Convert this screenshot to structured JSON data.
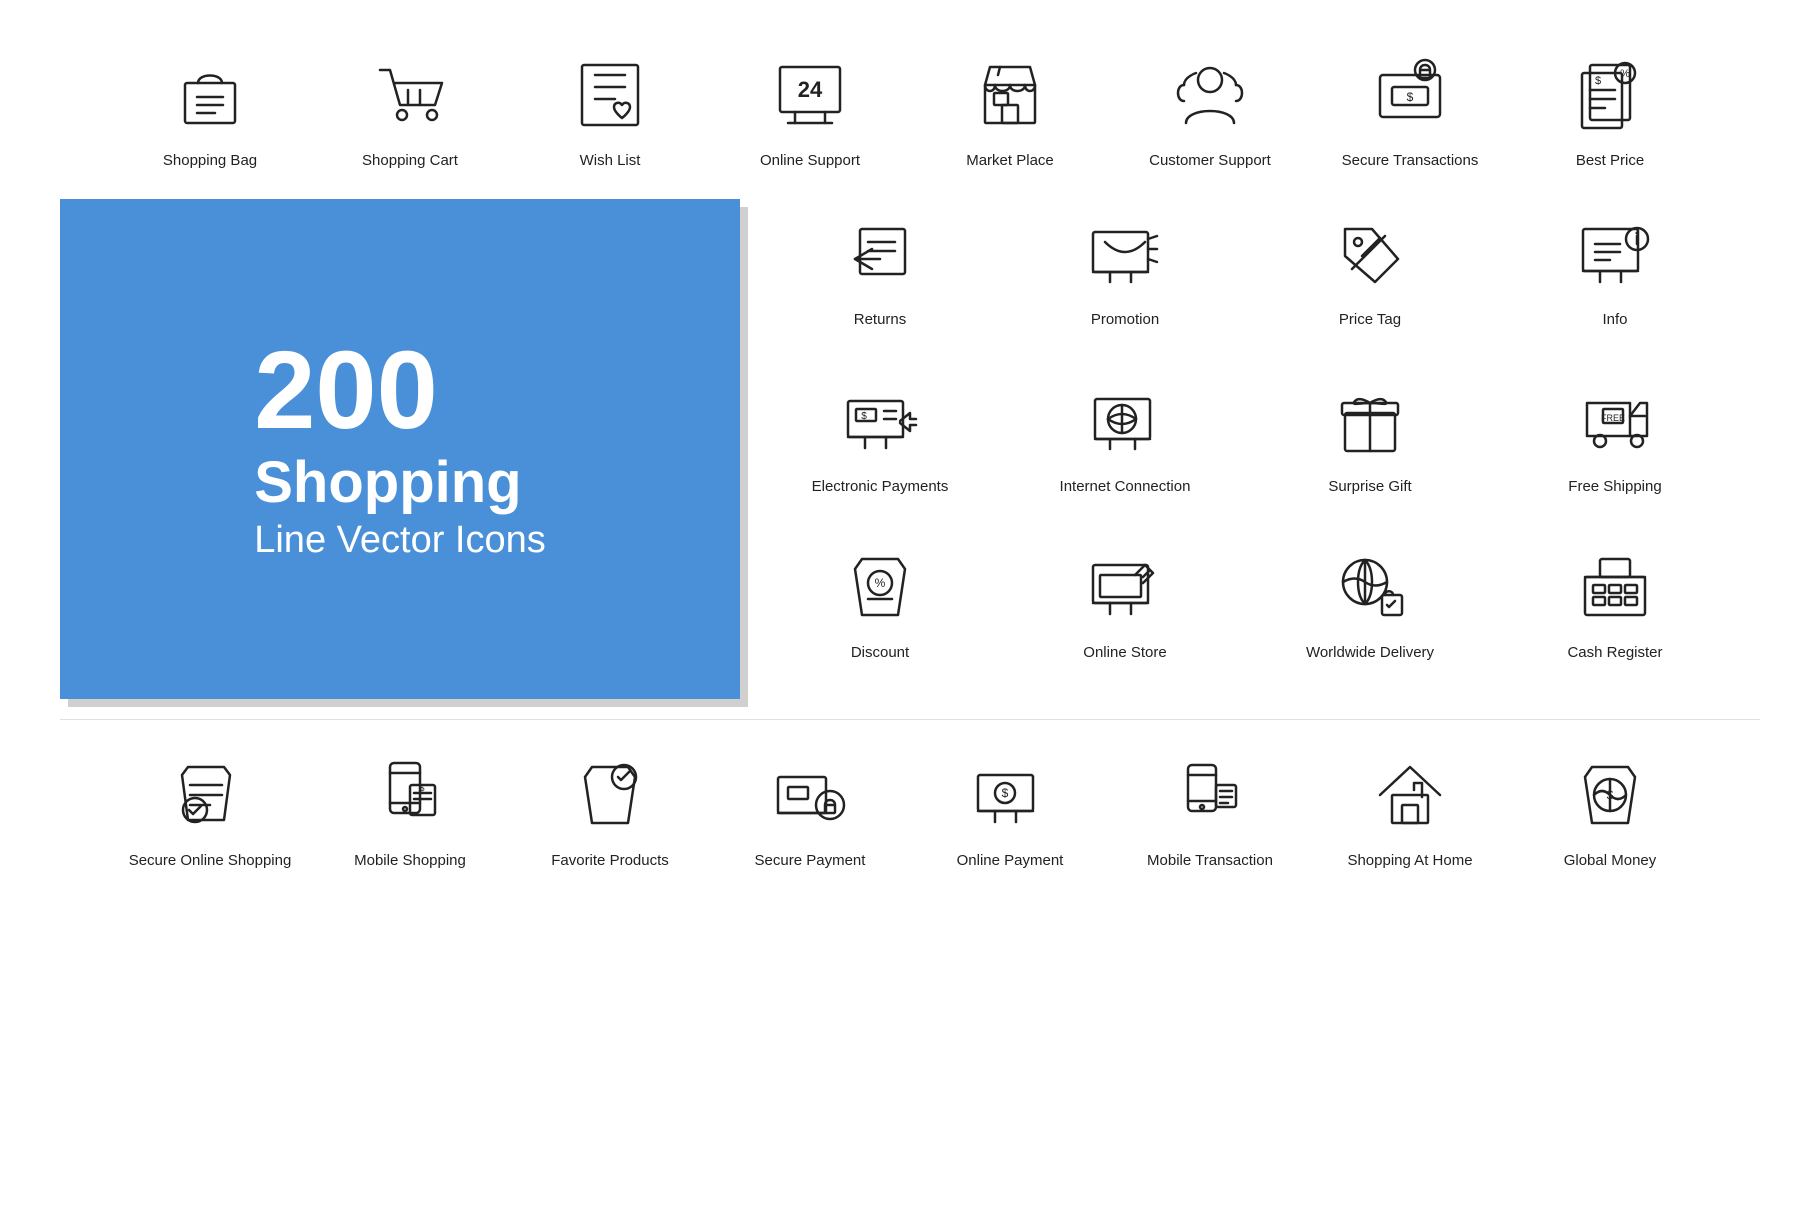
{
  "page": {
    "title": "200 Shopping Line Vector Icons",
    "blue_box": {
      "number": "200",
      "line1": "Shopping",
      "line2": "Line Vector Icons"
    },
    "top_row": [
      {
        "id": "shopping-bag",
        "label": "Shopping Bag"
      },
      {
        "id": "shopping-cart",
        "label": "Shopping Cart"
      },
      {
        "id": "wish-list",
        "label": "Wish List"
      },
      {
        "id": "online-support",
        "label": "Online Support"
      },
      {
        "id": "market-place",
        "label": "Market Place"
      },
      {
        "id": "customer-support",
        "label": "Customer Support"
      },
      {
        "id": "secure-transactions",
        "label": "Secure Transactions"
      },
      {
        "id": "best-price",
        "label": "Best Price"
      }
    ],
    "middle_right": [
      {
        "id": "returns",
        "label": "Returns"
      },
      {
        "id": "promotion",
        "label": "Promotion"
      },
      {
        "id": "price-tag",
        "label": "Price Tag"
      },
      {
        "id": "info",
        "label": "Info"
      },
      {
        "id": "electronic-payments",
        "label": "Electronic Payments"
      },
      {
        "id": "internet-connection",
        "label": "Internet Connection"
      },
      {
        "id": "surprise-gift",
        "label": "Surprise Gift"
      },
      {
        "id": "free-shipping",
        "label": "Free Shipping"
      },
      {
        "id": "discount",
        "label": "Discount"
      },
      {
        "id": "online-store",
        "label": "Online Store"
      },
      {
        "id": "worldwide-delivery",
        "label": "Worldwide Delivery"
      },
      {
        "id": "cash-register",
        "label": "Cash Register"
      }
    ],
    "bottom_row": [
      {
        "id": "secure-online-shopping",
        "label": "Secure Online Shopping"
      },
      {
        "id": "mobile-shopping",
        "label": "Mobile Shopping"
      },
      {
        "id": "favorite-products",
        "label": "Favorite Products"
      },
      {
        "id": "secure-payment",
        "label": "Secure Payment"
      },
      {
        "id": "online-payment",
        "label": "Online Payment"
      },
      {
        "id": "mobile-transaction",
        "label": "Mobile Transaction"
      },
      {
        "id": "shopping-at-home",
        "label": "Shopping At Home"
      },
      {
        "id": "global-money",
        "label": "Global Money"
      }
    ]
  }
}
